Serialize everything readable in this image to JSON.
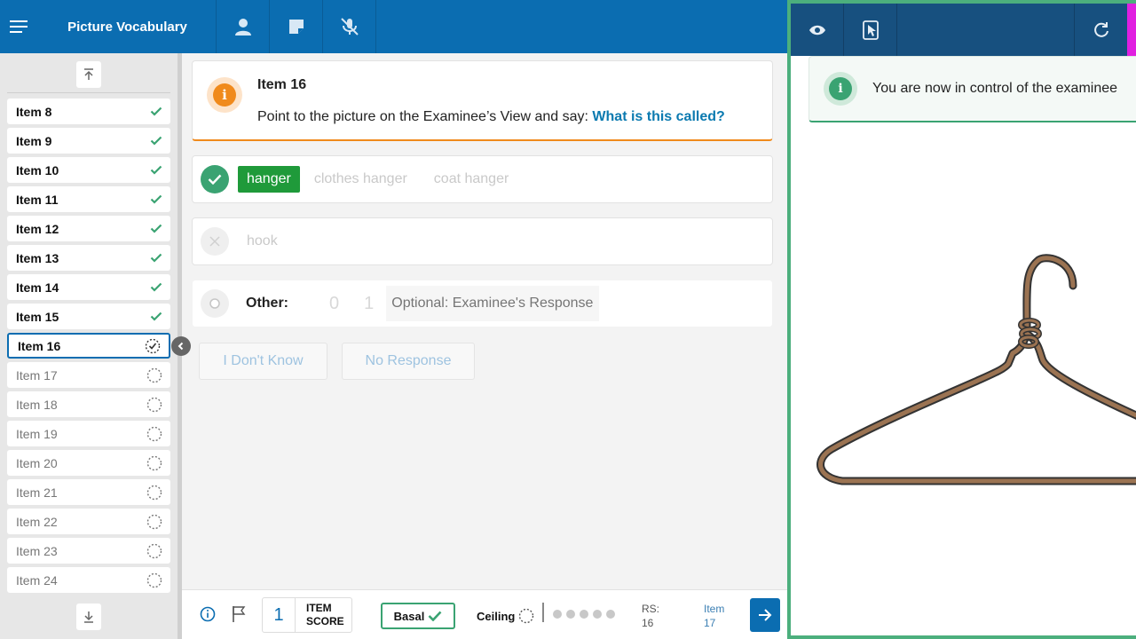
{
  "header": {
    "title": "Picture Vocabulary"
  },
  "sidebar": {
    "items": [
      {
        "label": "Item 8",
        "state": "done"
      },
      {
        "label": "Item 9",
        "state": "done"
      },
      {
        "label": "Item 10",
        "state": "done"
      },
      {
        "label": "Item 11",
        "state": "done"
      },
      {
        "label": "Item 12",
        "state": "done"
      },
      {
        "label": "Item 13",
        "state": "done"
      },
      {
        "label": "Item 14",
        "state": "done"
      },
      {
        "label": "Item 15",
        "state": "done"
      },
      {
        "label": "Item 16",
        "state": "current"
      },
      {
        "label": "Item 17",
        "state": "pending"
      },
      {
        "label": "Item 18",
        "state": "pending"
      },
      {
        "label": "Item 19",
        "state": "pending"
      },
      {
        "label": "Item 20",
        "state": "pending"
      },
      {
        "label": "Item 21",
        "state": "pending"
      },
      {
        "label": "Item 22",
        "state": "pending"
      },
      {
        "label": "Item 23",
        "state": "pending"
      },
      {
        "label": "Item 24",
        "state": "pending"
      }
    ]
  },
  "prompt": {
    "item_title": "Item 16",
    "instruction": "Point to the picture on the Examinee’s View and say: ",
    "question": "What is this called?"
  },
  "responses": {
    "correct": {
      "selected": "hanger",
      "alternates": [
        "clothes hanger",
        "coat hanger"
      ]
    },
    "incorrect": {
      "label": "hook"
    },
    "other": {
      "label": "Other:",
      "score_options": [
        "0",
        "1"
      ],
      "placeholder": "Optional: Examinee's Response"
    }
  },
  "buttons": {
    "dont_know": "I Don't Know",
    "no_response": "No Response"
  },
  "bottom": {
    "item_score_value": "1",
    "item_score_label_1": "ITEM",
    "item_score_label_2": "SCORE",
    "basal_label": "Basal",
    "ceiling_label": "Ceiling",
    "rs_label": "RS:",
    "rs_value": "16",
    "next_item_label": "Item",
    "next_item_value": "17"
  },
  "examinee_view": {
    "toast": "You are now in control of the examinee",
    "image_subject": "coat hanger"
  },
  "colors": {
    "primary": "#0b6db1",
    "success": "#3aa372",
    "warning": "#f08a1c",
    "examinee_header": "#17507f",
    "accent_magenta": "#e020e0",
    "hanger_brown": "#9b7352"
  }
}
